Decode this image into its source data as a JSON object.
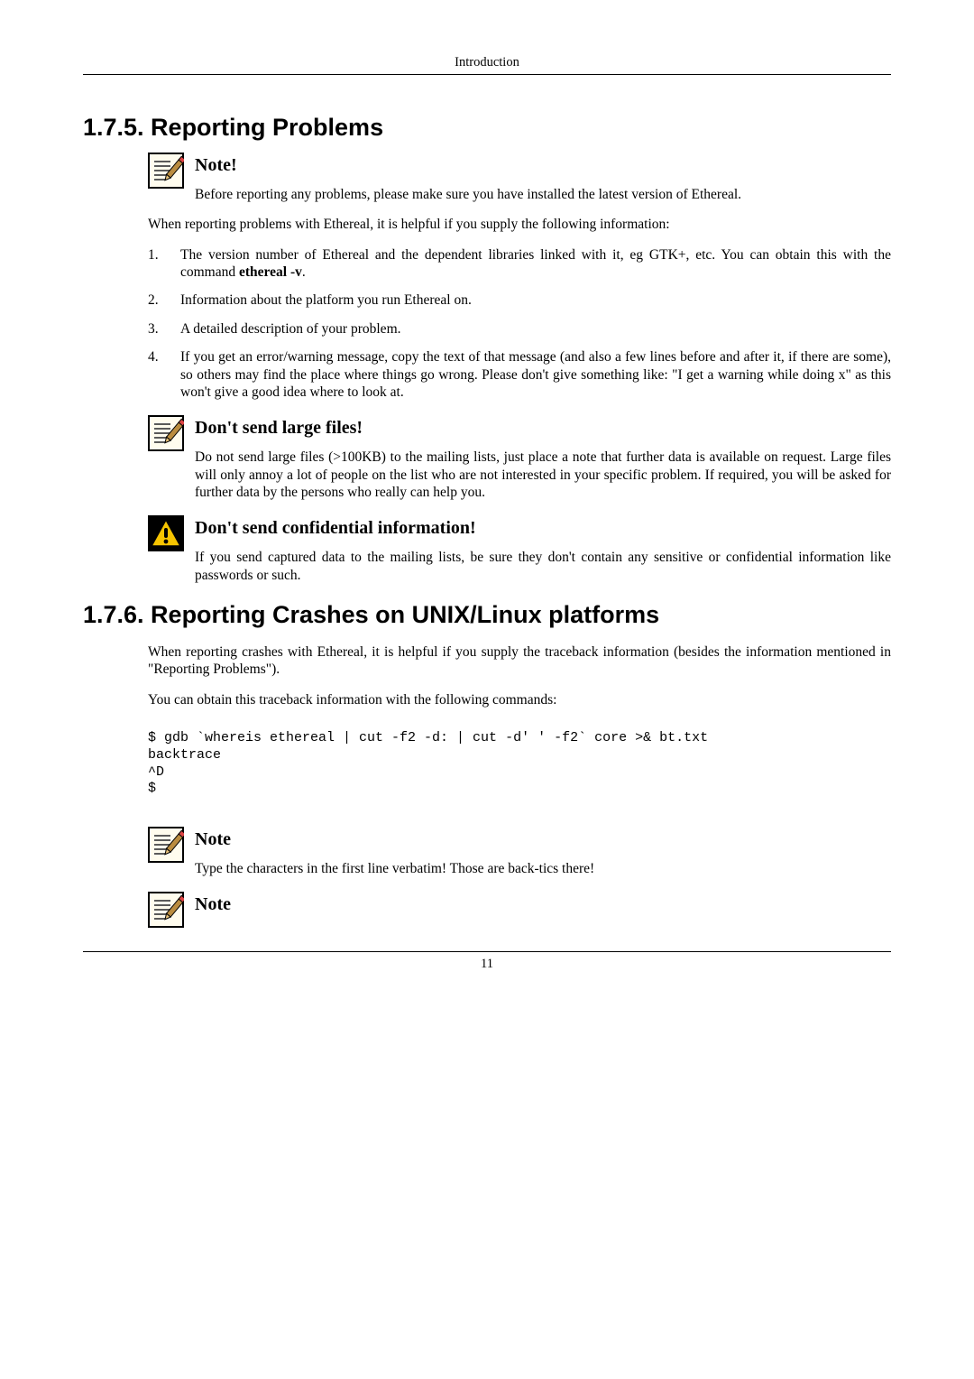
{
  "header": {
    "title": "Introduction"
  },
  "footer": {
    "page": "11"
  },
  "s175": {
    "heading": "1.7.5. Reporting Problems",
    "note1": {
      "title": "Note!",
      "text": "Before reporting any problems, please make sure you have installed the latest version of Ethereal."
    },
    "intro": "When reporting problems with Ethereal, it is helpful if you supply the following information:",
    "items": [
      {
        "pre": "The version number of Ethereal and the dependent libraries linked with it, eg GTK+, etc. You can obtain this with the command ",
        "cmd": "ethereal -v",
        "post": "."
      },
      {
        "text": "Information about the platform you run Ethereal on."
      },
      {
        "text": "A detailed description of your problem."
      },
      {
        "text": "If you get an error/warning message, copy the text of that message (and also a few lines before and after it, if there are some), so others may find the place where things go wrong. Please don't give something like: \"I get a warning while doing x\" as this won't give a good idea where to look at."
      }
    ],
    "note2": {
      "title": "Don't send large files!",
      "text": "Do not send large files (>100KB) to the mailing lists, just place a note that further data is available on request. Large files will only annoy a lot of people on the list who are not interested in your specific problem. If required, you will be asked for further data by the persons who really can help you."
    },
    "warn": {
      "title": "Don't send confidential information!",
      "text": "If you send captured data to the mailing lists, be sure they don't contain any sensitive or confidential information like passwords or such."
    }
  },
  "s176": {
    "heading": "1.7.6. Reporting Crashes on UNIX/Linux platforms",
    "p1": "When reporting crashes with Ethereal, it is helpful if you supply the traceback information (besides the information mentioned in \"Reporting Problems\").",
    "p2": "You can obtain this traceback information with the following commands:",
    "code": "$ gdb `whereis ethereal | cut -f2 -d: | cut -d' ' -f2` core >& bt.txt\nbacktrace\n^D\n$",
    "note1": {
      "title": "Note",
      "text": "Type the characters in the first line verbatim! Those are back-tics there!"
    },
    "note2": {
      "title": "Note"
    }
  }
}
